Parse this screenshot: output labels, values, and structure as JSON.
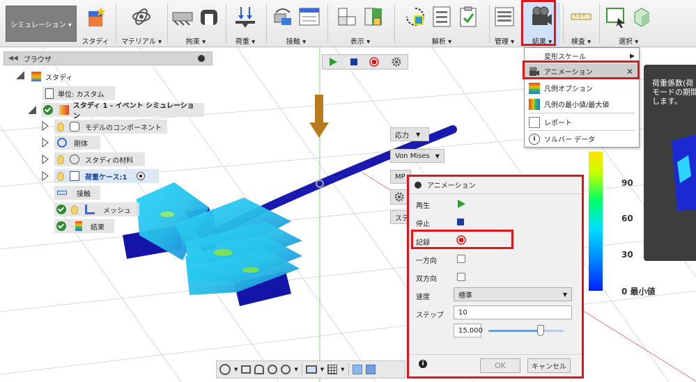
{
  "toolbar": {
    "workspace_label": "シミュレーション ▾",
    "groups": [
      {
        "label": "スタディ"
      },
      {
        "label": "マテリアル ▾"
      },
      {
        "label": "拘束 ▾"
      },
      {
        "label": "荷重 ▾"
      },
      {
        "label": "接触 ▾"
      },
      {
        "label": "表示 ▾"
      },
      {
        "label": "解析 ▾"
      },
      {
        "label": "管理 ▾"
      },
      {
        "label": "結果 ▾"
      },
      {
        "label": "検査 ▾"
      },
      {
        "label": "選択 ▾"
      }
    ]
  },
  "results_menu": {
    "items": [
      {
        "label": "変形スケール",
        "icon": "none",
        "submenu": "▶"
      },
      {
        "label": "アニメーション",
        "icon": "animation-icon",
        "close": "✕"
      },
      {
        "label": "凡例オプション",
        "icon": "legend-icon"
      },
      {
        "label": "凡例の最小値/最大値",
        "icon": "legend-minmax-icon"
      },
      {
        "label": "レポート",
        "icon": "report-icon"
      },
      {
        "label": "ソルバー データ",
        "icon": "info-icon"
      }
    ]
  },
  "tooltip": {
    "lines": [
      "荷重係数(荷",
      "モードの期間",
      "します。"
    ]
  },
  "browser": {
    "title": "ブラウザ",
    "nodes": [
      {
        "label": "スタディ"
      },
      {
        "label": "単位: カスタム"
      },
      {
        "label": "スタディ 1 - イベント シミュレーション"
      },
      {
        "label": "モデルのコンポーネント"
      },
      {
        "label": "剛体"
      },
      {
        "label": "スタディの材料"
      },
      {
        "label": "荷重ケース:1"
      },
      {
        "label": "接触"
      },
      {
        "label": "メッシュ"
      },
      {
        "label": "結果"
      }
    ]
  },
  "viewport_controls": {
    "stress_dropdown": "応力",
    "vonmises_dropdown": "Von Mises",
    "mpa_partial": "MP",
    "ste_partial": "ステ"
  },
  "legend": {
    "ticks": [
      "90",
      "60",
      "30",
      "0 最小値"
    ]
  },
  "animation_dialog": {
    "title": "アニメーション",
    "play_label": "再生",
    "stop_label": "停止",
    "record_label": "記録",
    "oneway_label": "一方向",
    "twoway_label": "双方向",
    "speed_label": "速度",
    "speed_value": "標準",
    "step_label": "ステップ",
    "step_value": "10",
    "slider_value": "15.000",
    "ok_label": "OK",
    "cancel_label": "キャンセル",
    "oneway_checked": false,
    "twoway_checked": false
  },
  "colors": {
    "highlight_red": "#e2141a",
    "play_green": "#2aa52a",
    "stop_blue": "#1a3fa0",
    "part_blue": "#1a1aa0"
  }
}
